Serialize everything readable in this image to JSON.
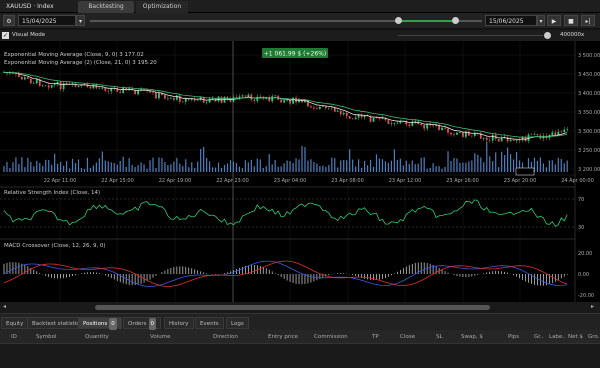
{
  "tabs": {
    "symbol": "XAUUSD · Index",
    "backtesting": "Backtesting",
    "optimization": "Optimization"
  },
  "toolbar": {
    "start_date": "15/04/2025",
    "end_date": "15/06/2025"
  },
  "options": {
    "visual_mode": "Visual Mode",
    "speed_label": "400000x"
  },
  "chart": {
    "profit_label": "+1 061.99 $ (+26%)",
    "ema_label_1": "Exponential Moving Average (Close, 9, 0) 3 177.02",
    "ema_label_2": "Exponential Moving Average (2) (Close, 21, 0) 3 195.20",
    "rsi_label": "Relative Strength Index (Close, 14)",
    "macd_label": "MACD Crossover (Close, 12, 26, 9, 0)",
    "price_ticks": [
      "3 500.00",
      "3 450.00",
      "3 400.00",
      "3 350.00",
      "3 300.00",
      "3 250.00",
      "3 200.00"
    ],
    "rsi_ticks": [
      "70",
      "30"
    ],
    "macd_ticks": [
      "20.00",
      "0.00",
      "-20.00"
    ],
    "time_ticks": [
      "22 Apr 11:00",
      "22 Apr 15:00",
      "22 Apr 19:00",
      "22 Apr 23:00",
      "23 Apr 04:00",
      "23 Apr 08:00",
      "23 Apr 12:00",
      "23 Apr 16:00",
      "23 Apr 20:00",
      "24 Apr 00:00"
    ],
    "colors": {
      "bull": "#2ecc71",
      "bear": "#e05050",
      "ema_fast": "#e0e0e0",
      "ema_slow": "#3fbf6f",
      "volume": "#4d7fbf",
      "rsi": "#2ecc71",
      "macd": "#3b5bdb",
      "signal": "#e03131"
    }
  },
  "bottom_tabs": [
    {
      "label": "Equity"
    },
    {
      "label": "Backtest statistics"
    },
    {
      "label": "Positions",
      "badge": "0"
    },
    {
      "label": "Orders",
      "badge": "0"
    },
    {
      "label": "History"
    },
    {
      "label": "Events"
    },
    {
      "label": "Logs"
    }
  ],
  "columns": [
    "ID",
    "Symbol",
    "Quantity",
    "Volume",
    "Direction",
    "Entry price",
    "Commission",
    "TP",
    "Close",
    "SL",
    "Swap, $",
    "Pips",
    "Gr..",
    "Labe..",
    "Net $",
    "Gro.."
  ]
}
